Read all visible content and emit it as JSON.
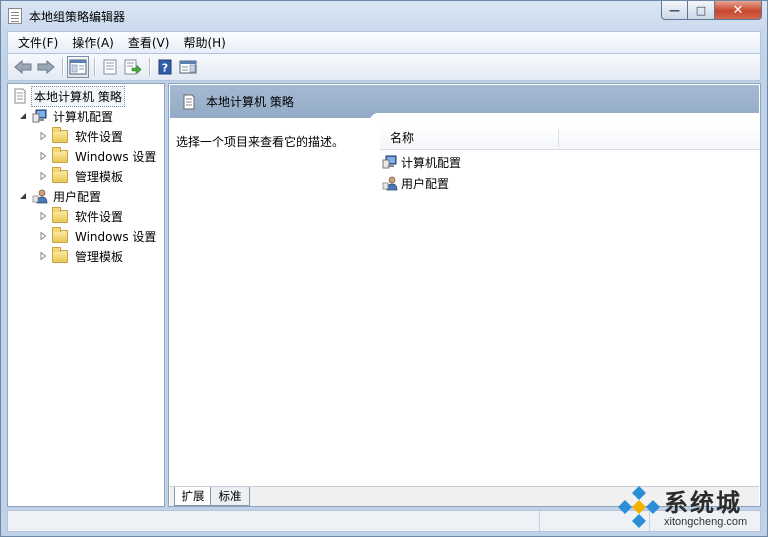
{
  "window": {
    "title": "本地组策略编辑器",
    "minimize_symbol": "—",
    "maximize_symbol": "□",
    "close_symbol": "✕"
  },
  "menubar": {
    "items": [
      {
        "label": "文件(F)"
      },
      {
        "label": "操作(A)"
      },
      {
        "label": "查看(V)"
      },
      {
        "label": "帮助(H)"
      }
    ]
  },
  "toolbar": {
    "buttons": [
      "back-icon",
      "forward-icon",
      "show-hide-tree-icon",
      "properties-icon",
      "export-list-icon",
      "help-icon",
      "show-hide-action-pane-icon"
    ]
  },
  "tree": {
    "root": {
      "label": "本地计算机 策略"
    },
    "computer_config": {
      "label": "计算机配置",
      "children": [
        {
          "label": "软件设置"
        },
        {
          "label": "Windows 设置"
        },
        {
          "label": "管理模板"
        }
      ]
    },
    "user_config": {
      "label": "用户配置",
      "children": [
        {
          "label": "软件设置"
        },
        {
          "label": "Windows 设置"
        },
        {
          "label": "管理模板"
        }
      ]
    }
  },
  "details": {
    "header_title": "本地计算机 策略",
    "description": "选择一个项目来查看它的描述。",
    "column_name": "名称",
    "items": [
      {
        "label": "计算机配置"
      },
      {
        "label": "用户配置"
      }
    ]
  },
  "tabs": {
    "extended": "扩展",
    "standard": "标准"
  },
  "watermark": {
    "brand": "系统城",
    "url": "xitongcheng.com"
  }
}
